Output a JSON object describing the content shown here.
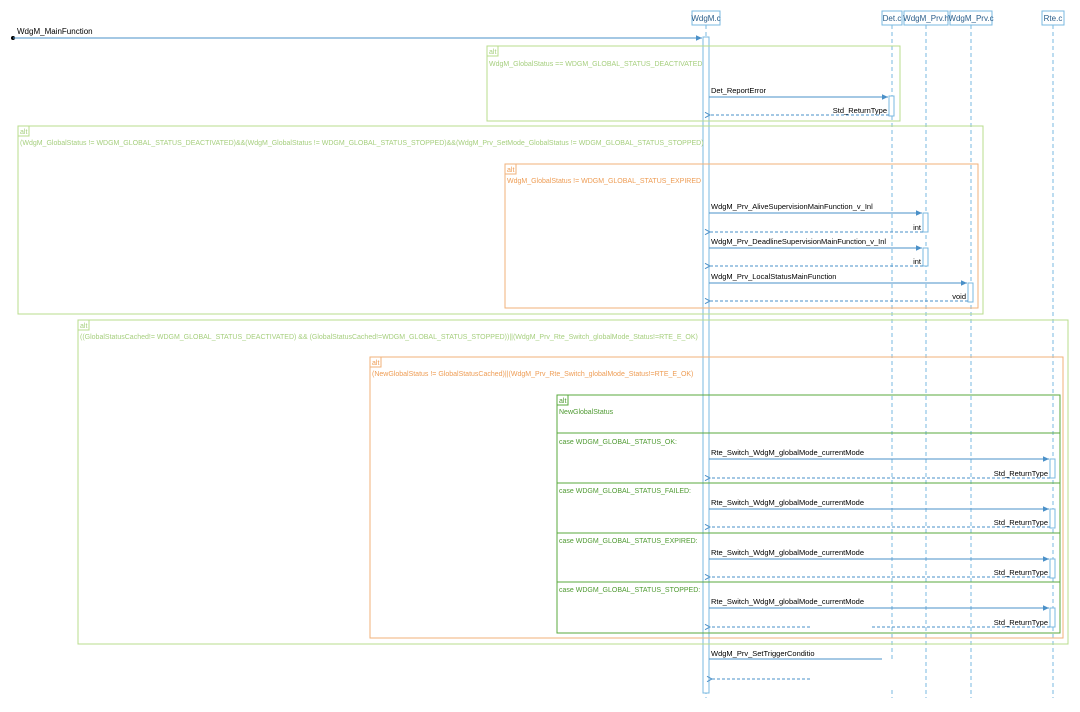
{
  "lifelines": {
    "wdgm_c": "WdgM.c",
    "det_c": "Det.c",
    "wdgm_prv_h": "WdgM_Prv.h",
    "wdgm_prv_c": "WdgM_Prv.c",
    "rte_c": "Rte.c"
  },
  "entry_message": "WdgM_MainFunction",
  "frames": {
    "alt1": {
      "tag": "alt",
      "guard": "WdgM_GlobalStatus == WDGM_GLOBAL_STATUS_DEACTIVATED"
    },
    "alt2": {
      "tag": "alt",
      "guard": "(WdgM_GlobalStatus != WDGM_GLOBAL_STATUS_DEACTIVATED)&&(WdgM_GlobalStatus != WDGM_GLOBAL_STATUS_STOPPED)&&(WdgM_Prv_SetMode_GlobalStatus != WDGM_GLOBAL_STATUS_STOPPED)"
    },
    "alt3": {
      "tag": "alt",
      "guard": "WdgM_GlobalStatus != WDGM_GLOBAL_STATUS_EXPIRED"
    },
    "alt4": {
      "tag": "alt",
      "guard": "((GlobalStatusCached!= WDGM_GLOBAL_STATUS_DEACTIVATED) && (GlobalStatusCached!=WDGM_GLOBAL_STATUS_STOPPED))||(WdgM_Prv_Rte_Switch_globalMode_Status!=RTE_E_OK)"
    },
    "alt5": {
      "tag": "alt",
      "guard": "(NewGlobalStatus != GlobalStatusCached)||(WdgM_Prv_Rte_Switch_globalMode_Status!=RTE_E_OK)"
    },
    "alt6": {
      "tag": "alt",
      "guard": "NewGlobalStatus"
    }
  },
  "cases": {
    "ok": "case WDGM_GLOBAL_STATUS_OK:",
    "failed": "case WDGM_GLOBAL_STATUS_FAILED:",
    "expired": "case WDGM_GLOBAL_STATUS_EXPIRED:",
    "stopped": "case WDGM_GLOBAL_STATUS_STOPPED:"
  },
  "messages": {
    "det_report": "Det_ReportError",
    "det_return": "Std_ReturnType",
    "alive": "WdgM_Prv_AliveSupervisionMainFunction_v_Inl",
    "alive_return": "int",
    "deadline": "WdgM_Prv_DeadlineSupervisionMainFunction_v_Inl",
    "deadline_return": "int",
    "local": "WdgM_Prv_LocalStatusMainFunction",
    "local_return": "void",
    "rte_switch": "Rte_Switch_WdgM_globalMode_currentMode",
    "rte_return": "Std_ReturnType",
    "set_trigger": "WdgM_Prv_SetTriggerConditio"
  },
  "colors": {
    "message": "#4a90c8",
    "lifeline": "#7ab8e0",
    "frame_light_green": "#b8dc8c",
    "frame_orange": "#f2b27a",
    "frame_dark_green": "#5aa83c",
    "guard_light_green": "#a6cf7e",
    "guard_orange": "#ee9d55",
    "guard_dark_green": "#4f9a32"
  }
}
